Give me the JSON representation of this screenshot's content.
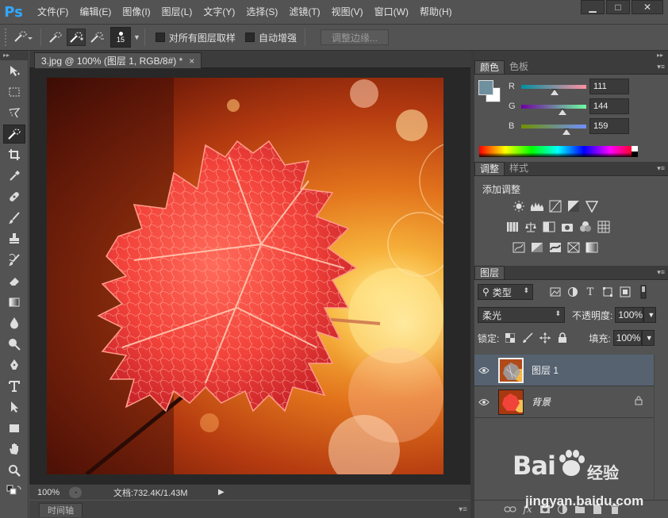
{
  "app": {
    "logo": "Ps"
  },
  "menu": [
    "文件(F)",
    "编辑(E)",
    "图像(I)",
    "图层(L)",
    "文字(Y)",
    "选择(S)",
    "滤镜(T)",
    "视图(V)",
    "窗口(W)",
    "帮助(H)"
  ],
  "window_controls": {
    "minimize": "▁",
    "maximize": "□",
    "close": "✕"
  },
  "options": {
    "brush_size": "15",
    "sample_all_layers": "对所有图层取样",
    "auto_enhance": "自动增强",
    "refine_edge": "调整边缘..."
  },
  "document": {
    "tab_title": "3.jpg @ 100% (图层 1, RGB/8#) *",
    "tab_close": "×",
    "zoom": "100%",
    "doc_info": "文档:732.4K/1.43M",
    "timeline_tab": "时间轴"
  },
  "color_panel": {
    "tabs": [
      "颜色",
      "色板"
    ],
    "fg_color": "#6f909f",
    "bg_color": "#ffffff",
    "channels": [
      {
        "label": "R",
        "value": "111"
      },
      {
        "label": "G",
        "value": "144"
      },
      {
        "label": "B",
        "value": "159"
      }
    ]
  },
  "adjust_panel": {
    "tabs": [
      "调整",
      "样式"
    ],
    "title": "添加调整"
  },
  "layers_panel": {
    "tab": "图层",
    "filter_kind": "类型",
    "blend_mode": "柔光",
    "opacity_label": "不透明度:",
    "opacity_value": "100%",
    "lock_label": "锁定:",
    "fill_label": "填充:",
    "fill_value": "100%",
    "layers": [
      {
        "name": "图层 1",
        "selected": true
      },
      {
        "name": "背景",
        "selected": false,
        "locked": true
      }
    ]
  },
  "watermark": {
    "brand": "Bai",
    "brand_cn": "经验",
    "url": "jingyan.baidu.com"
  }
}
